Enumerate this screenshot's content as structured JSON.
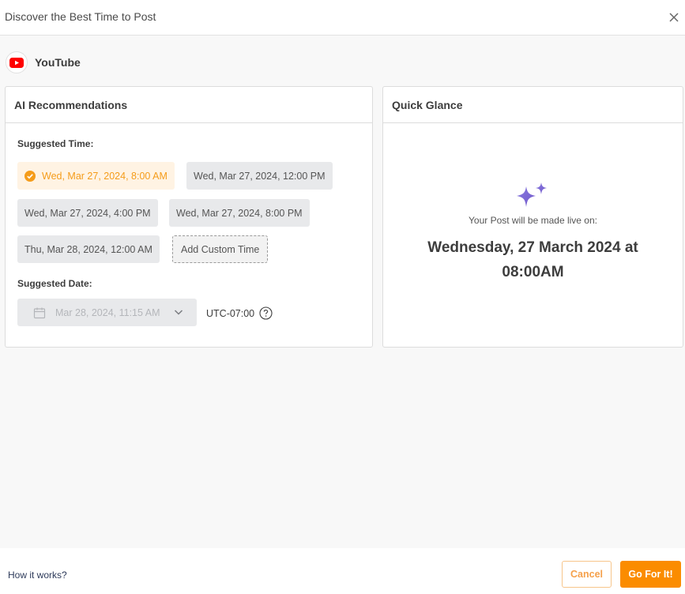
{
  "header": {
    "title": "Discover the Best Time to Post",
    "close_icon": "close-icon"
  },
  "platform": {
    "name": "YouTube",
    "icon": "youtube-icon",
    "brand_color": "#ff0000"
  },
  "ai_recommendations": {
    "title": "AI Recommendations",
    "suggested_time_label": "Suggested Time:",
    "times": [
      {
        "label": "Wed, Mar 27, 2024, 8:00 AM",
        "selected": true
      },
      {
        "label": "Wed, Mar 27, 2024, 12:00 PM",
        "selected": false
      },
      {
        "label": "Wed, Mar 27, 2024, 4:00 PM",
        "selected": false
      },
      {
        "label": "Wed, Mar 27, 2024, 8:00 PM",
        "selected": false
      },
      {
        "label": "Thu, Mar 28, 2024, 12:00 AM",
        "selected": false
      }
    ],
    "add_custom_label": "Add Custom Time",
    "suggested_date_label": "Suggested Date:",
    "date_value": "Mar 28, 2024, 11:15 AM",
    "timezone": "UTC-07:00"
  },
  "quick_glance": {
    "title": "Quick Glance",
    "live_label": "Your Post will be made live on:",
    "live_date": "Wednesday, 27 March 2024 at 08:00AM",
    "icon": "sparkle-icon",
    "icon_color": "#7b68d8"
  },
  "footer": {
    "how_it_works": "How it works?",
    "cancel_label": "Cancel",
    "go_label": "Go For It!"
  },
  "colors": {
    "accent": "#fb8c00",
    "selected_text": "#f59c1a",
    "selected_bg": "#fff3e3"
  }
}
